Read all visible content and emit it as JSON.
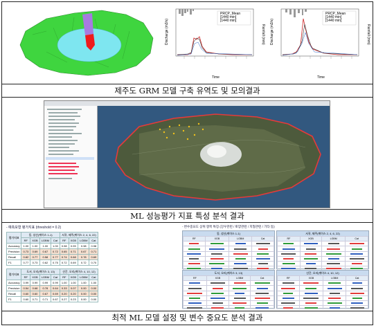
{
  "captions": {
    "row1": "제주도 GRM 모델 구축 유역도 및 모의결과",
    "row2": "ML 성능평가 지표 특성 분석 결과",
    "row3": "최적 ML 모델 설정 및 변수 중요도 분석 결과"
  },
  "hydrographs": [
    {
      "legend": [
        "OBS",
        "PRCP_Mean",
        "[1440 min]",
        "[1440 min]"
      ],
      "ylabel": "Discharge (m3/s)",
      "y2label": "Rainfall (mm)",
      "xlabel": "Time",
      "y_ticks": [
        "0",
        "100",
        "200",
        "300",
        "400",
        "500",
        "600",
        "700",
        "800"
      ],
      "y2_ticks": [
        "0",
        "25",
        "50",
        "75"
      ]
    },
    {
      "legend": [
        "OBS",
        "PRCP_Mean",
        "[1440 min]",
        "[1440 min]"
      ],
      "ylabel": "Discharge (m3/s)",
      "y2label": "Rainfall (mm)",
      "xlabel": "Time",
      "y_ticks": [
        "0",
        "100",
        "200",
        "300",
        "400",
        "500",
        "600",
        "700"
      ],
      "y2_ticks": [
        "0",
        "25",
        "50",
        "75"
      ]
    }
  ],
  "ml_eval": {
    "title": "- 예측모형 평가지표 (threshold = 0.2)",
    "blocks": [
      {
        "label": "평가지표",
        "groups": [
          "동, 성산(케이스 1-1)",
          "서귀, 제주(케이스 2, 4, 6, 22)"
        ],
        "cols": [
          "RF",
          "XGB",
          "LGBM",
          "Cat",
          "RF",
          "XGB",
          "LGBM",
          "Cat"
        ],
        "rows": [
          {
            "name": "Accuracy",
            "vals": [
              "1.00",
              "1.00",
              "1.00",
              "1.00",
              "0.98",
              "0.99",
              "0.98",
              "0.98"
            ]
          },
          {
            "name": "Precision",
            "vals": [
              "0.73",
              "0.69",
              "0.67",
              "0.72",
              "0.65",
              "0.71",
              "0.67",
              "0.71"
            ]
          },
          {
            "name": "Recall",
            "vals": [
              "0.82",
              "0.77",
              "0.58",
              "0.77",
              "0.74",
              "0.68",
              "0.78",
              "0.69"
            ]
          },
          {
            "name": "F1",
            "vals": [
              "0.77",
              "0.73",
              "0.62",
              "0.75",
              "0.72",
              "0.69",
              "0.72",
              "0.70"
            ]
          }
        ]
      },
      {
        "label": "평가지표",
        "groups": [
          "도서, 오리(케이스 3, 13)",
          "산간, 오리(케이스 4, 10, 12)"
        ],
        "cols": [
          "RF",
          "XGB",
          "LGBM",
          "Cat",
          "RF",
          "XGB",
          "LGBM",
          "Cat"
        ],
        "rows": [
          {
            "name": "Accuracy",
            "vals": [
              "0.99",
              "0.99",
              "0.99",
              "0.99",
              "1.00",
              "1.00",
              "1.00",
              "1.00"
            ]
          },
          {
            "name": "Precision",
            "vals": [
              "0.54",
              "0.68",
              "0.78",
              "0.64",
              "0.33",
              "0.07",
              "0.00",
              "0.00"
            ]
          },
          {
            "name": "Recall",
            "vals": [
              "0.60",
              "0.60",
              "0.67",
              "0.69",
              "0.20",
              "0.20",
              "0.00",
              "0.00"
            ]
          },
          {
            "name": "F1",
            "vals": [
              "0.60",
              "0.71",
              "0.71",
              "0.67",
              "0.27",
              "0.23",
              "0.00",
              "0.00"
            ]
          }
        ]
      }
    ]
  },
  "importance": {
    "title": "- 변수중요도 상위 항목 특징 (강우관련 / 토양관련 / 지형관련 / 기타 등)",
    "panels": [
      {
        "title": "동, 성산(케이스 1-1)",
        "cols": [
          "RF",
          "XGB",
          "LGBM",
          "Cat"
        ]
      },
      {
        "title": "서귀, 제주(케이스 2, 4, 6, 22)",
        "cols": [
          "RF",
          "XGB",
          "LGBM",
          "Cat"
        ]
      },
      {
        "title": "도서, 오리(케이스 3, 13)",
        "cols": [
          "RF",
          "XGB",
          "LGBM",
          "Cat"
        ]
      },
      {
        "title": "산간, 오리(케이스 4, 10, 12)",
        "cols": [
          "RF",
          "XGB",
          "LGBM",
          "Cat"
        ]
      }
    ]
  },
  "colors": {
    "rain": "#e23b3b",
    "soil": "#2f9b3a",
    "terrain": "#2f5fbf",
    "highlight": "#f7e0d0",
    "map_green": "#3fd53f",
    "map_cyan": "#7ee6f0"
  }
}
